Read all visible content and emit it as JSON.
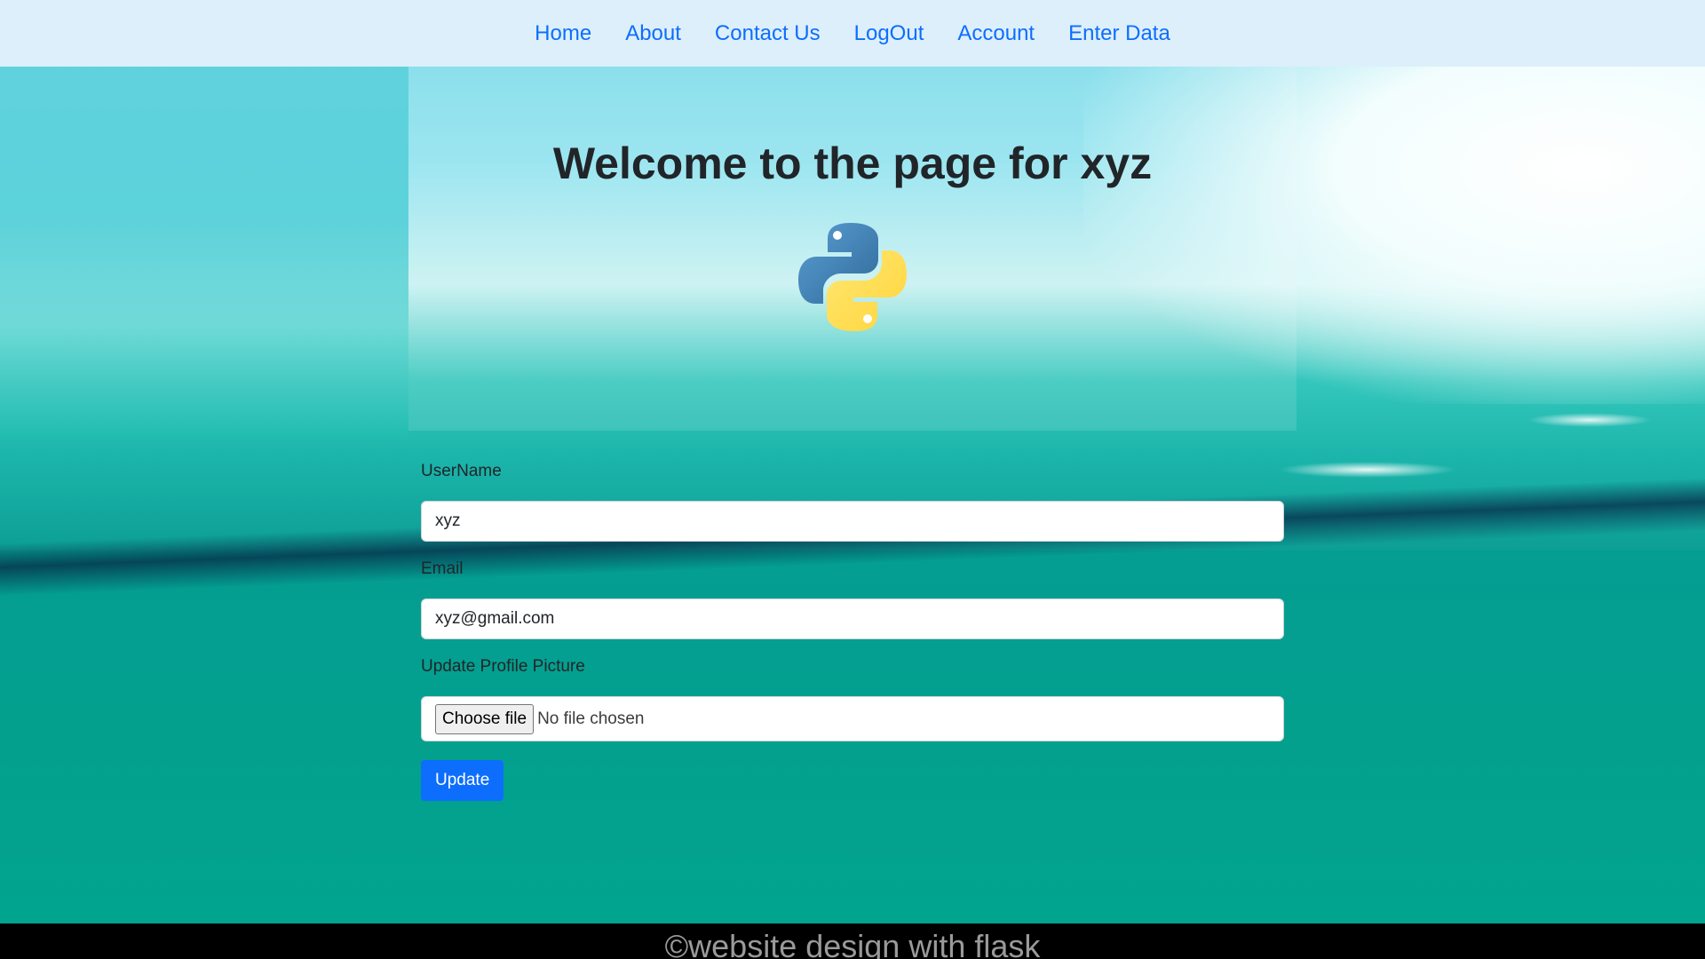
{
  "nav": {
    "items": [
      "Home",
      "About",
      "Contact Us",
      "LogOut",
      "Account",
      "Enter Data"
    ]
  },
  "hero": {
    "title": "Welcome to the page for xyz",
    "logo_icon": "python-logo-icon"
  },
  "form": {
    "username_label": "UserName",
    "username_value": "xyz",
    "email_label": "Email",
    "email_value": "xyz@gmail.com",
    "picture_label": "Update Profile Picture",
    "choose_file_label": "Choose file",
    "file_status": "No file chosen",
    "submit_label": "Update"
  },
  "footer": {
    "text": "©website design with flask"
  },
  "colors": {
    "link": "#0d6efd",
    "primary_button": "#0d6efd",
    "navbar_bg": "#ddeffb",
    "footer_bg": "#000000"
  }
}
